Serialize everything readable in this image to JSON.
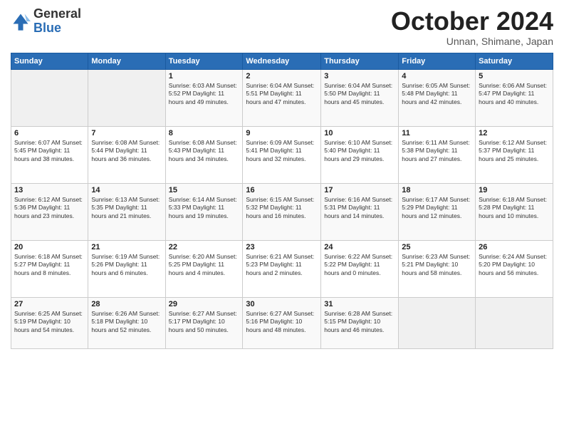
{
  "header": {
    "logo": {
      "general": "General",
      "blue": "Blue"
    },
    "title": "October 2024",
    "subtitle": "Unnan, Shimane, Japan"
  },
  "weekdays": [
    "Sunday",
    "Monday",
    "Tuesday",
    "Wednesday",
    "Thursday",
    "Friday",
    "Saturday"
  ],
  "weeks": [
    [
      {
        "day": "",
        "info": ""
      },
      {
        "day": "",
        "info": ""
      },
      {
        "day": "1",
        "info": "Sunrise: 6:03 AM\nSunset: 5:52 PM\nDaylight: 11 hours and 49 minutes."
      },
      {
        "day": "2",
        "info": "Sunrise: 6:04 AM\nSunset: 5:51 PM\nDaylight: 11 hours and 47 minutes."
      },
      {
        "day": "3",
        "info": "Sunrise: 6:04 AM\nSunset: 5:50 PM\nDaylight: 11 hours and 45 minutes."
      },
      {
        "day": "4",
        "info": "Sunrise: 6:05 AM\nSunset: 5:48 PM\nDaylight: 11 hours and 42 minutes."
      },
      {
        "day": "5",
        "info": "Sunrise: 6:06 AM\nSunset: 5:47 PM\nDaylight: 11 hours and 40 minutes."
      }
    ],
    [
      {
        "day": "6",
        "info": "Sunrise: 6:07 AM\nSunset: 5:45 PM\nDaylight: 11 hours and 38 minutes."
      },
      {
        "day": "7",
        "info": "Sunrise: 6:08 AM\nSunset: 5:44 PM\nDaylight: 11 hours and 36 minutes."
      },
      {
        "day": "8",
        "info": "Sunrise: 6:08 AM\nSunset: 5:43 PM\nDaylight: 11 hours and 34 minutes."
      },
      {
        "day": "9",
        "info": "Sunrise: 6:09 AM\nSunset: 5:41 PM\nDaylight: 11 hours and 32 minutes."
      },
      {
        "day": "10",
        "info": "Sunrise: 6:10 AM\nSunset: 5:40 PM\nDaylight: 11 hours and 29 minutes."
      },
      {
        "day": "11",
        "info": "Sunrise: 6:11 AM\nSunset: 5:38 PM\nDaylight: 11 hours and 27 minutes."
      },
      {
        "day": "12",
        "info": "Sunrise: 6:12 AM\nSunset: 5:37 PM\nDaylight: 11 hours and 25 minutes."
      }
    ],
    [
      {
        "day": "13",
        "info": "Sunrise: 6:12 AM\nSunset: 5:36 PM\nDaylight: 11 hours and 23 minutes."
      },
      {
        "day": "14",
        "info": "Sunrise: 6:13 AM\nSunset: 5:35 PM\nDaylight: 11 hours and 21 minutes."
      },
      {
        "day": "15",
        "info": "Sunrise: 6:14 AM\nSunset: 5:33 PM\nDaylight: 11 hours and 19 minutes."
      },
      {
        "day": "16",
        "info": "Sunrise: 6:15 AM\nSunset: 5:32 PM\nDaylight: 11 hours and 16 minutes."
      },
      {
        "day": "17",
        "info": "Sunrise: 6:16 AM\nSunset: 5:31 PM\nDaylight: 11 hours and 14 minutes."
      },
      {
        "day": "18",
        "info": "Sunrise: 6:17 AM\nSunset: 5:29 PM\nDaylight: 11 hours and 12 minutes."
      },
      {
        "day": "19",
        "info": "Sunrise: 6:18 AM\nSunset: 5:28 PM\nDaylight: 11 hours and 10 minutes."
      }
    ],
    [
      {
        "day": "20",
        "info": "Sunrise: 6:18 AM\nSunset: 5:27 PM\nDaylight: 11 hours and 8 minutes."
      },
      {
        "day": "21",
        "info": "Sunrise: 6:19 AM\nSunset: 5:26 PM\nDaylight: 11 hours and 6 minutes."
      },
      {
        "day": "22",
        "info": "Sunrise: 6:20 AM\nSunset: 5:25 PM\nDaylight: 11 hours and 4 minutes."
      },
      {
        "day": "23",
        "info": "Sunrise: 6:21 AM\nSunset: 5:23 PM\nDaylight: 11 hours and 2 minutes."
      },
      {
        "day": "24",
        "info": "Sunrise: 6:22 AM\nSunset: 5:22 PM\nDaylight: 11 hours and 0 minutes."
      },
      {
        "day": "25",
        "info": "Sunrise: 6:23 AM\nSunset: 5:21 PM\nDaylight: 10 hours and 58 minutes."
      },
      {
        "day": "26",
        "info": "Sunrise: 6:24 AM\nSunset: 5:20 PM\nDaylight: 10 hours and 56 minutes."
      }
    ],
    [
      {
        "day": "27",
        "info": "Sunrise: 6:25 AM\nSunset: 5:19 PM\nDaylight: 10 hours and 54 minutes."
      },
      {
        "day": "28",
        "info": "Sunrise: 6:26 AM\nSunset: 5:18 PM\nDaylight: 10 hours and 52 minutes."
      },
      {
        "day": "29",
        "info": "Sunrise: 6:27 AM\nSunset: 5:17 PM\nDaylight: 10 hours and 50 minutes."
      },
      {
        "day": "30",
        "info": "Sunrise: 6:27 AM\nSunset: 5:16 PM\nDaylight: 10 hours and 48 minutes."
      },
      {
        "day": "31",
        "info": "Sunrise: 6:28 AM\nSunset: 5:15 PM\nDaylight: 10 hours and 46 minutes."
      },
      {
        "day": "",
        "info": ""
      },
      {
        "day": "",
        "info": ""
      }
    ]
  ]
}
